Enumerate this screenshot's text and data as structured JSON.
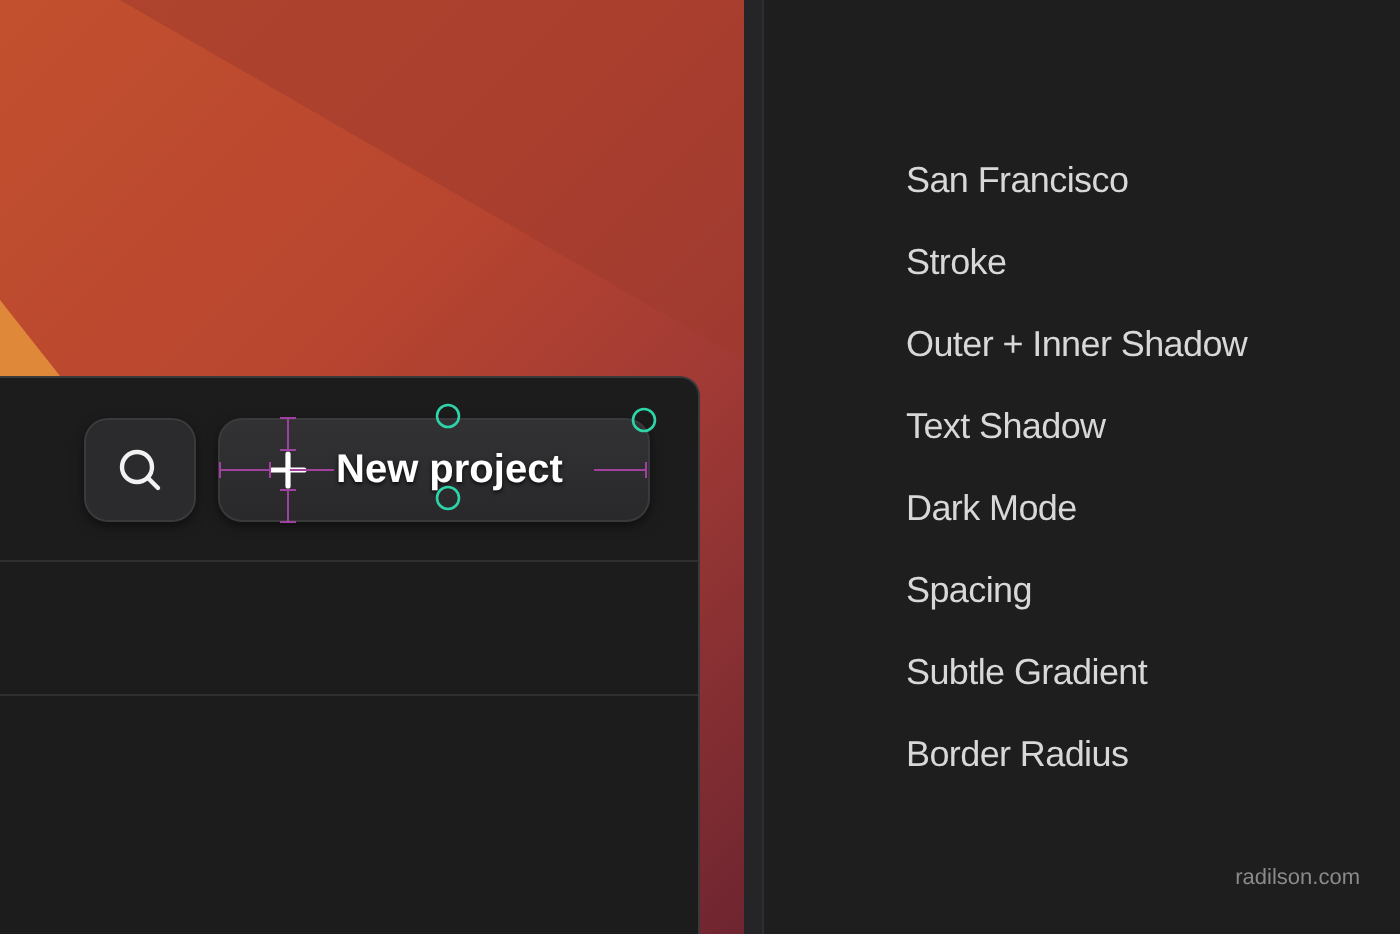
{
  "toolbar": {
    "new_project_label": "New project"
  },
  "features": [
    "San Francisco",
    "Stroke",
    "Outer + Inner Shadow",
    "Text Shadow",
    "Dark Mode",
    "Spacing",
    "Subtle Gradient",
    "Border Radius"
  ],
  "credit": "radilson.com"
}
